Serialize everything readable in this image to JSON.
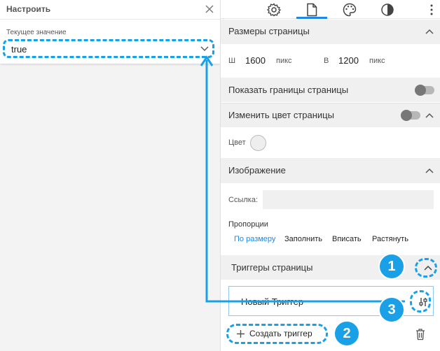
{
  "left_panel": {
    "title": "Настроить",
    "current_value_label": "Текущее значение",
    "current_value": "true"
  },
  "right_panel": {
    "tabs": [
      {
        "icon": "gear-icon"
      },
      {
        "icon": "page-icon",
        "active": true
      },
      {
        "icon": "palette-icon"
      },
      {
        "icon": "contrast-icon"
      },
      {
        "icon": "more-vertical-icon"
      }
    ],
    "page_size": {
      "header": "Размеры страницы",
      "width_label": "Ш",
      "width_value": "1600",
      "width_unit": "пикс",
      "height_label": "В",
      "height_value": "1200",
      "height_unit": "пикс"
    },
    "show_borders": {
      "label": "Показать границы страницы",
      "enabled": false
    },
    "change_color": {
      "label": "Изменить цвет страницы",
      "enabled": false,
      "color_label": "Цвет"
    },
    "image": {
      "header": "Изображение",
      "link_label": "Ссылка:",
      "link_value": "",
      "proportions_label": "Пропорции",
      "proportion_options": [
        "По размеру",
        "Заполнить",
        "Вписать",
        "Растянуть"
      ],
      "selected_option": "По размеру"
    },
    "triggers": {
      "header": "Триггеры страницы",
      "trigger_name": "Новый Триггер",
      "create_label": "Создать триггер"
    }
  },
  "annotations": {
    "badge_1": "1",
    "badge_2": "2",
    "badge_3": "3",
    "accent_color": "#1aa0e6"
  },
  "colors": {
    "active_tab": "#1e88e5",
    "selected_option": "#1e88e5",
    "section_bg": "#f0f0f0"
  }
}
